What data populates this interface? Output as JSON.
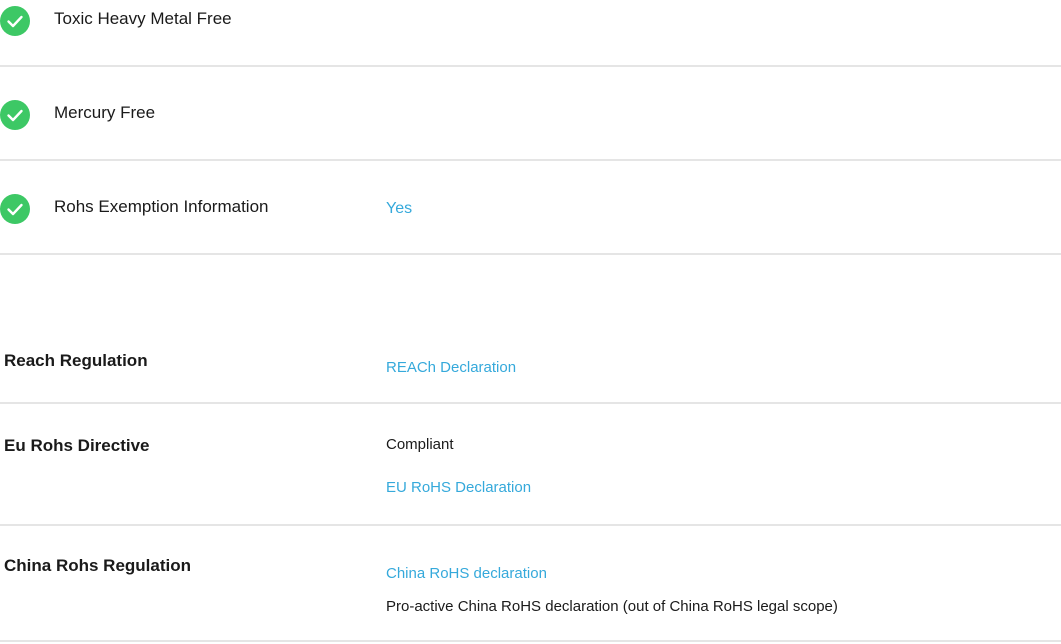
{
  "checks": [
    {
      "label": "Toxic Heavy Metal Free",
      "value": ""
    },
    {
      "label": "Mercury Free",
      "value": ""
    },
    {
      "label": "Rohs Exemption Information",
      "value": "Yes"
    }
  ],
  "regulations": [
    {
      "title": "Reach Regulation",
      "lines": [
        "REACh Declaration"
      ]
    },
    {
      "title": "Eu Rohs Directive",
      "lines": [
        "Compliant",
        "EU RoHS Declaration"
      ]
    },
    {
      "title": "China Rohs Regulation",
      "lines": [
        "China RoHS declaration",
        "Pro-active China RoHS declaration (out of China RoHS legal scope)"
      ]
    }
  ],
  "colors": {
    "check_green": "#3dc865",
    "link": "#35a9db",
    "divider": "#e5e5e5"
  },
  "icons": {
    "check": "check-circle-icon"
  }
}
